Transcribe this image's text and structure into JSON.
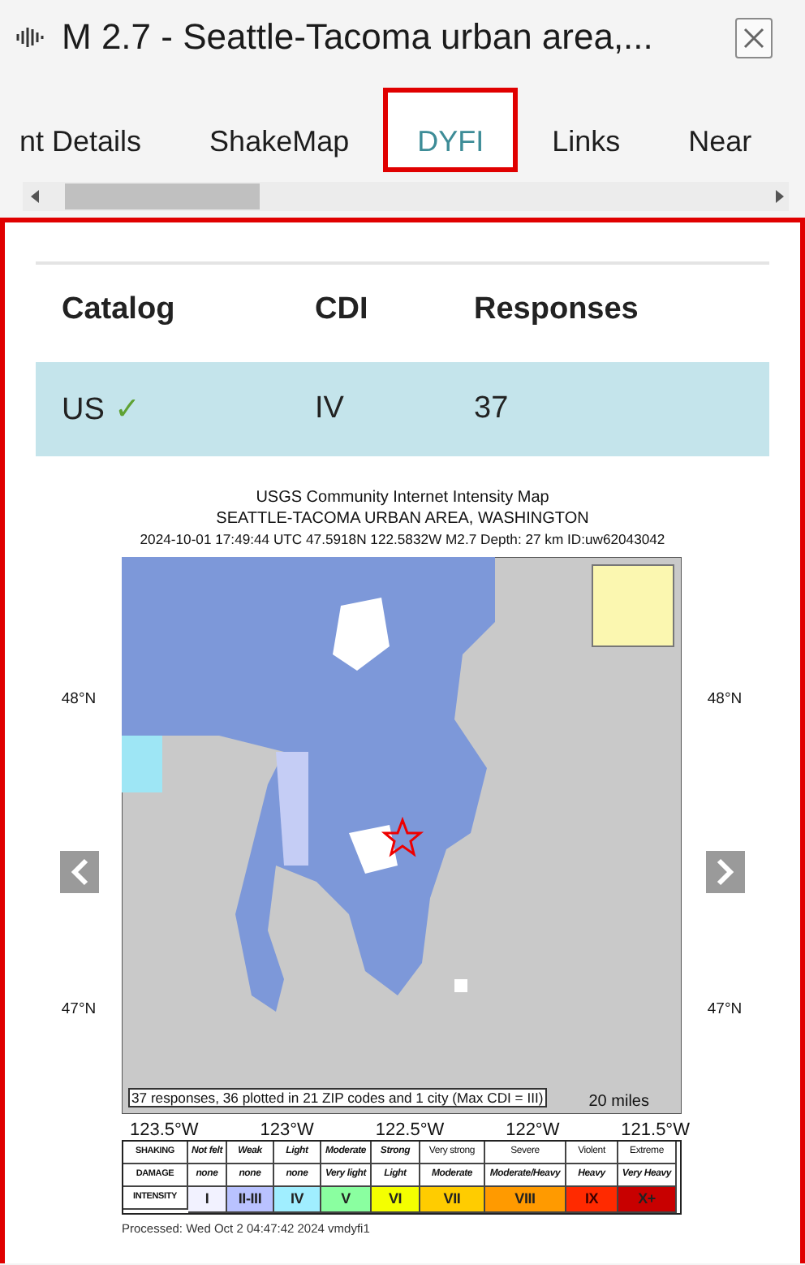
{
  "window": {
    "title": "M 2.7 - Seattle-Tacoma urban area,..."
  },
  "tabs": [
    {
      "label": "nt Details",
      "selected": false
    },
    {
      "label": "ShakeMap",
      "selected": false
    },
    {
      "label": "DYFI",
      "selected": true
    },
    {
      "label": "Links",
      "selected": false
    },
    {
      "label": "Near",
      "selected": false
    }
  ],
  "table": {
    "columns": [
      "Catalog",
      "CDI",
      "Responses"
    ],
    "rows": [
      {
        "cells": [
          "US",
          "IV",
          "37"
        ],
        "check": "✓",
        "selected": true
      }
    ]
  },
  "map": {
    "title_lines": [
      "USGS Community Internet Intensity Map",
      "SEATTLE-TACOMA URBAN AREA, WASHINGTON",
      "2024-10-01 17:49:44 UTC 47.5918N 122.5832W M2.7 Depth: 27 km ID:uw62043042"
    ],
    "lat_labels_left": [
      "48°N",
      "47°N"
    ],
    "lat_labels_right": [
      "48°N",
      "47°N"
    ],
    "lon_labels": [
      "123.5°W",
      "123°W",
      "122.5°W",
      "122°W",
      "121.5°W"
    ],
    "caption": "37 responses, 36 plotted in 21 ZIP codes and 1 city (Max CDI = III)",
    "scale": "20 miles",
    "legend": [
      {
        "label": "SHAKING",
        "cells": [
          {
            "text": "Not felt"
          },
          {
            "text": "Weak"
          },
          {
            "text": "Light"
          },
          {
            "text": "Moderate"
          },
          {
            "text": "Strong"
          },
          {
            "text": "Very strong"
          },
          {
            "text": "Severe"
          },
          {
            "text": "Violent"
          },
          {
            "text": "Extreme"
          }
        ]
      },
      {
        "label": "DAMAGE",
        "cells": [
          {
            "text": "none"
          },
          {
            "text": "none"
          },
          {
            "text": "none"
          },
          {
            "text": "Very light"
          },
          {
            "text": "Light"
          },
          {
            "text": "Moderate"
          },
          {
            "text": "Moderate/Heavy"
          },
          {
            "text": "Heavy"
          },
          {
            "text": "Very Heavy"
          }
        ]
      },
      {
        "label": "INTENSITY",
        "cells": [
          {
            "text": "I",
            "color": "#f2f2ff"
          },
          {
            "text": "II-III",
            "color": "#b9c2ff"
          },
          {
            "text": "IV",
            "color": "#a0eeff"
          },
          {
            "text": "V",
            "color": "#8affa0"
          },
          {
            "text": "VI",
            "color": "#f4ff00"
          },
          {
            "text": "VII",
            "color": "#ffcc00"
          },
          {
            "text": "VIII",
            "color": "#ff9a00"
          },
          {
            "text": "IX",
            "color": "#ff2a00"
          },
          {
            "text": "X+",
            "color": "#c80000"
          }
        ]
      }
    ],
    "processed": "Processed: Wed Oct  2 04:47:42 2024 vmdyfi1"
  }
}
